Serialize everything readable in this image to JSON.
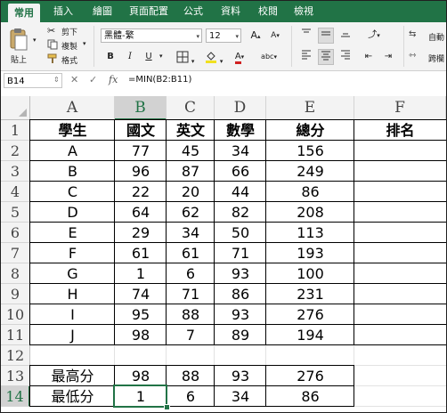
{
  "ribbon": {
    "tabs": [
      "常用",
      "插入",
      "繪圖",
      "頁面配置",
      "公式",
      "資料",
      "校閱",
      "檢視"
    ],
    "paste_label": "貼上",
    "cut_label": "剪下",
    "copy_label": "複製",
    "format_painter_label": "格式",
    "font_name": "黑體-繁",
    "font_size": "12",
    "bold_label": "B",
    "italic_label": "I",
    "underline_label": "U",
    "font_grow_label": "A",
    "font_shrink_label": "A",
    "font_color_label": "A",
    "phonetic_label": "abc",
    "wrap_label": "自動",
    "merge_label": "跨欄"
  },
  "formula_bar": {
    "name_box": "B14",
    "fx_label": "fx",
    "formula": "=MIN(B2:B11)"
  },
  "sheet": {
    "columns": [
      "A",
      "B",
      "C",
      "D",
      "E",
      "F"
    ],
    "rows": [
      "1",
      "2",
      "3",
      "4",
      "5",
      "6",
      "7",
      "8",
      "9",
      "10",
      "11",
      "12",
      "13",
      "14"
    ],
    "header": [
      "學生",
      "國文",
      "英文",
      "數學",
      "總分",
      "排名"
    ],
    "data": [
      [
        "A",
        "77",
        "45",
        "34",
        "156",
        ""
      ],
      [
        "B",
        "96",
        "87",
        "66",
        "249",
        ""
      ],
      [
        "C",
        "22",
        "20",
        "44",
        "86",
        ""
      ],
      [
        "D",
        "64",
        "62",
        "82",
        "208",
        ""
      ],
      [
        "E",
        "29",
        "34",
        "50",
        "113",
        ""
      ],
      [
        "F",
        "61",
        "61",
        "71",
        "193",
        ""
      ],
      [
        "G",
        "1",
        "6",
        "93",
        "100",
        ""
      ],
      [
        "H",
        "74",
        "71",
        "86",
        "231",
        ""
      ],
      [
        "I",
        "95",
        "88",
        "93",
        "276",
        ""
      ],
      [
        "J",
        "98",
        "7",
        "89",
        "194",
        ""
      ]
    ],
    "summary": [
      [
        "最高分",
        "98",
        "88",
        "93",
        "276"
      ],
      [
        "最低分",
        "1",
        "6",
        "34",
        "86"
      ]
    ],
    "selected_cell": "B14",
    "selected_column": "B",
    "selected_row": "14"
  },
  "colors": {
    "accent": "#217346",
    "grid": "#e2e2e2",
    "header_bg": "#f3f3f3"
  }
}
